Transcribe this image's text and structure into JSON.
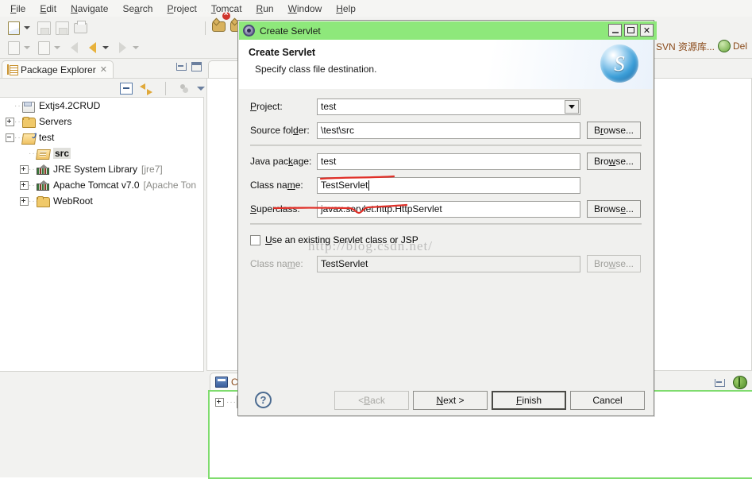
{
  "menubar": {
    "items": [
      {
        "label": "File",
        "mnemonic": "F"
      },
      {
        "label": "Edit",
        "mnemonic": "E"
      },
      {
        "label": "Navigate",
        "mnemonic": "N"
      },
      {
        "label": "Search",
        "mnemonic": "a"
      },
      {
        "label": "Project",
        "mnemonic": "P"
      },
      {
        "label": "Tomcat",
        "mnemonic": "T"
      },
      {
        "label": "Run",
        "mnemonic": "R"
      },
      {
        "label": "Window",
        "mnemonic": "W"
      },
      {
        "label": "Help",
        "mnemonic": "H"
      }
    ]
  },
  "toolbar": {
    "icons_row1": [
      "new-icon",
      "dropdown-caret",
      "save-icon",
      "save-all-icon",
      "print-icon",
      "tomcat-start-icon",
      "tomcat-stop-icon"
    ],
    "icons_row2": [
      "import-icon",
      "dropdown-caret",
      "export-icon",
      "dropdown-caret",
      "back-disabled-icon",
      "back-icon",
      "dropdown-caret",
      "forward-icon",
      "dropdown-caret"
    ],
    "right": {
      "svn_label": "SVN 资源库...",
      "debug_label": "Del"
    }
  },
  "package_explorer": {
    "tab_title": "Package Explorer",
    "close_glyph": "✕",
    "tree": [
      {
        "label": "Extjs4.2CRUD",
        "icon": "project-closed-icon",
        "expander": "none",
        "indent": 0,
        "selected": false,
        "suffix": ""
      },
      {
        "label": "Servers",
        "icon": "folder-icon",
        "expander": "plus",
        "indent": 0,
        "selected": false,
        "suffix": ""
      },
      {
        "label": "test",
        "icon": "java-project-icon",
        "expander": "minus",
        "indent": 0,
        "selected": false,
        "suffix": ""
      },
      {
        "label": "src",
        "icon": "source-folder-icon",
        "expander": "none",
        "indent": 1,
        "selected": true,
        "suffix": ""
      },
      {
        "label": "JRE System Library",
        "icon": "library-icon",
        "expander": "plus",
        "indent": 1,
        "selected": false,
        "suffix": "[jre7]"
      },
      {
        "label": "Apache Tomcat v7.0",
        "icon": "library-icon",
        "expander": "plus",
        "indent": 1,
        "selected": false,
        "suffix": "[Apache Ton"
      },
      {
        "label": "WebRoot",
        "icon": "folder-icon",
        "expander": "plus",
        "indent": 1,
        "selected": false,
        "suffix": ""
      }
    ]
  },
  "bottom_view": {
    "tab_title": "Co"
  },
  "dialog": {
    "window_title": "Create Servlet",
    "window_buttons": {
      "minimize": "_",
      "maximize": "□",
      "close": "✕"
    },
    "header": {
      "title": "Create Servlet",
      "subtitle": "Specify class file destination.",
      "logo_letter": "S"
    },
    "fields": {
      "project": {
        "label": "Project:",
        "mnemonic": "P",
        "value": "test",
        "type": "combo"
      },
      "source_folder": {
        "label": "Source folder:",
        "mnemonic": "d",
        "value": "\\test\\src",
        "browse": "Browse..."
      },
      "java_package": {
        "label": "Java package:",
        "mnemonic": "k",
        "value": "test",
        "browse": "Browse..."
      },
      "class_name": {
        "label": "Class name:",
        "mnemonic": "m",
        "value": "TestServlet"
      },
      "superclass": {
        "label": "Superclass:",
        "mnemonic": "S",
        "value": "javax.servlet.http.HttpServlet",
        "browse": "Browse..."
      },
      "use_existing": {
        "label": "Use an existing Servlet class or JSP",
        "mnemonic": "U",
        "checked": false
      },
      "existing_class_name": {
        "label": "Class name:",
        "mnemonic": "m",
        "value": "TestServlet",
        "browse": "Browse...",
        "disabled": true
      }
    },
    "buttons": {
      "help": "?",
      "back": "< Back",
      "next": "Next >",
      "finish": "Finish",
      "cancel": "Cancel"
    },
    "colors": {
      "titlebar": "#8ee87b",
      "dialog_bg": "#f0f0ee",
      "annotation": "#e03028"
    }
  },
  "watermark": {
    "text": "http://blog.csdn.net/"
  }
}
